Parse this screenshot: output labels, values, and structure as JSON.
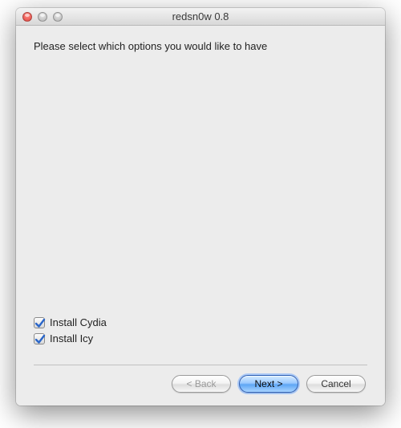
{
  "window": {
    "title": "redsn0w 0.8"
  },
  "prompt": "Please select which options you would like to have",
  "options": [
    {
      "label": "Install Cydia",
      "checked": true
    },
    {
      "label": "Install Icy",
      "checked": true
    }
  ],
  "buttons": {
    "back": "< Back",
    "next": "Next >",
    "cancel": "Cancel"
  },
  "back_enabled": false
}
